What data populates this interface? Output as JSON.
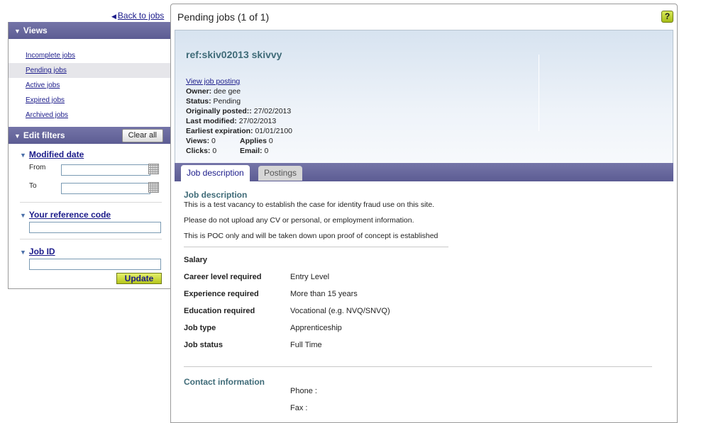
{
  "nav": {
    "back_label": "Back to jobs"
  },
  "views": {
    "title": "Views",
    "items": [
      {
        "label": "Incomplete jobs"
      },
      {
        "label": "Pending jobs"
      },
      {
        "label": "Active jobs"
      },
      {
        "label": "Expired jobs"
      },
      {
        "label": "Archived jobs"
      }
    ]
  },
  "filters": {
    "title": "Edit filters",
    "clear_label": "Clear all",
    "modified_date": {
      "label": "Modified date",
      "from_label": "From",
      "to_label": "To",
      "from_value": "",
      "to_value": ""
    },
    "reference_code": {
      "label": "Your reference code",
      "value": ""
    },
    "job_id": {
      "label": "Job ID",
      "value": ""
    },
    "update_label": "Update"
  },
  "main": {
    "title": "Pending jobs (1 of 1)",
    "help_label": "?",
    "job": {
      "ref_title": "ref:skiv02013 skivvy",
      "view_link": "View job posting",
      "owner_label": "Owner:",
      "owner": "dee gee",
      "status_label": "Status:",
      "status": "Pending",
      "posted_label": "Originally posted::",
      "posted": "27/02/2013",
      "modified_label": "Last modified:",
      "modified": "27/02/2013",
      "expiration_label": "Earliest expiration:",
      "expiration": "01/01/2100",
      "views_label": "Views:",
      "views": "0",
      "applies_label": "Applies",
      "applies": "0",
      "clicks_label": "Clicks:",
      "clicks": "0",
      "email_label": "Email:",
      "email": "0"
    },
    "tabs": [
      {
        "label": "Job description"
      },
      {
        "label": "Postings"
      }
    ],
    "description": {
      "heading": "Job description",
      "paragraphs": [
        "This is a test vacancy to establish the case for identity fraud use on this site.",
        "Please do not upload any CV or personal, or employment information.",
        "This is POC only and will be taken down upon proof of concept is established"
      ],
      "salary_label": "Salary",
      "details": [
        {
          "key": "Career level required",
          "value": "Entry Level"
        },
        {
          "key": "Experience required",
          "value": "More than 15 years"
        },
        {
          "key": "Education required",
          "value": "Vocational (e.g. NVQ/SNVQ)"
        },
        {
          "key": "Job type",
          "value": "Apprenticeship"
        },
        {
          "key": "Job status",
          "value": "Full Time"
        }
      ],
      "contact_heading": "Contact information",
      "phone_label": "Phone :",
      "fax_label": "Fax :"
    }
  },
  "colors": {
    "accent_bar": "#6a6aa0",
    "link": "#1b1b8a",
    "heading_teal": "#3f6b78",
    "button_green": "#c8d82e"
  }
}
